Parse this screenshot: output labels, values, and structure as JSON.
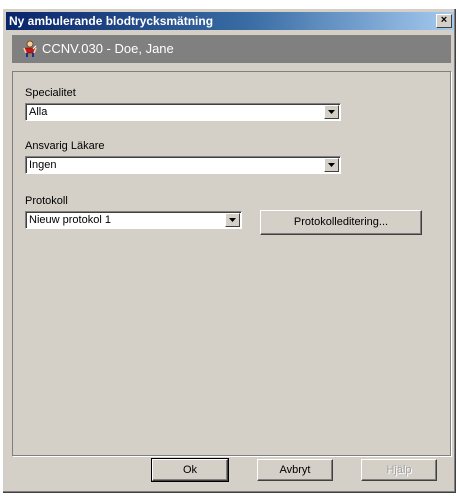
{
  "window": {
    "title": "Ny ambulerande blodtrycksmätning",
    "close_label": "×"
  },
  "patient": {
    "name": "CCNV.030 - Doe, Jane",
    "icon": "patient-figure-icon"
  },
  "fields": {
    "specialitet": {
      "label": "Specialitet",
      "value": "Alla"
    },
    "ansvarig": {
      "label": "Ansvarig Läkare",
      "value": "Ingen"
    },
    "protokoll": {
      "label": "Protokoll",
      "value": "Nieuw protokol 1"
    }
  },
  "buttons": {
    "protokolleditering": "Protokolleditering...",
    "ok": "Ok",
    "avbryt": "Avbryt",
    "hjalp": "Hjälp"
  },
  "colors": {
    "titlebar_start": "#0a246a",
    "titlebar_end": "#a6caf0",
    "patient_bar": "#808080",
    "face": "#d4d0c8"
  }
}
